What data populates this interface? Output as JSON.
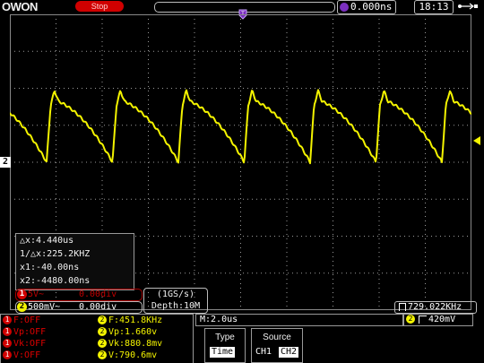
{
  "header": {
    "brand": "OWON",
    "run_status": "Stop",
    "time_offset": "0.000ns",
    "clock": "18:13"
  },
  "cursor": {
    "dx": "△x:4.440us",
    "inv_dx": "1/△x:225.2KHZ",
    "x1": "x1:-40.00ns",
    "x2": "x2:-4480.00ns"
  },
  "channels": {
    "ch1": {
      "num": "1",
      "scale": "5V~",
      "pos": "0.00div"
    },
    "ch2": {
      "num": "2",
      "scale": "500mV~",
      "pos": "0.00div"
    }
  },
  "acquisition": {
    "rate": "(1GS/s)",
    "depth": "Depth:10M"
  },
  "trigger_freq": "729.022KHz",
  "measurements": {
    "ch1": [
      {
        "num": "1",
        "text": "F:OFF"
      },
      {
        "num": "1",
        "text": "Vp:OFF"
      },
      {
        "num": "1",
        "text": "Vk:OFF"
      },
      {
        "num": "1",
        "text": "V:OFF"
      }
    ],
    "ch2": [
      {
        "num": "2",
        "text": "F:451.8KHz"
      },
      {
        "num": "2",
        "text": "Vp:1.660v"
      },
      {
        "num": "2",
        "text": "Vk:880.8mv"
      },
      {
        "num": "2",
        "text": "V:790.6mv"
      }
    ]
  },
  "timebase": "M:2.0us",
  "trigger": {
    "num": "2",
    "level": "420mV"
  },
  "menu": {
    "type_title": "Type",
    "type_value": "Time",
    "source_title": "Source",
    "source_options": [
      "CH1",
      "CH2"
    ],
    "source_selected": "CH2"
  },
  "markers": {
    "ch2_label": "2",
    "trig_pos_label": "T"
  },
  "colors": {
    "ch1": "#d00000",
    "ch2": "#f4f400",
    "grid": "#9a9a9a",
    "background": "#000000"
  }
}
